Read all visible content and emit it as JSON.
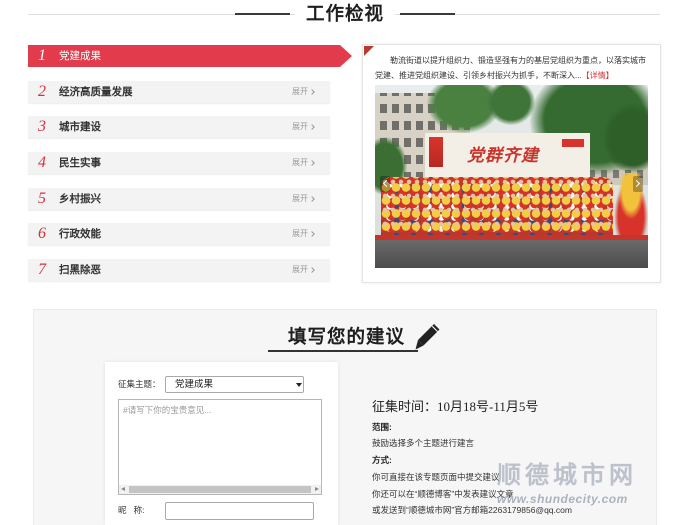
{
  "section_title": "工作检视",
  "topics": [
    {
      "num": "1",
      "label": "党建成果",
      "active": true
    },
    {
      "num": "2",
      "label": "经济高质量发展",
      "expand": "展开"
    },
    {
      "num": "3",
      "label": "城市建设",
      "expand": "展开"
    },
    {
      "num": "4",
      "label": "民生实事",
      "expand": "展开"
    },
    {
      "num": "5",
      "label": "乡村振兴",
      "expand": "展开"
    },
    {
      "num": "6",
      "label": "行政效能",
      "expand": "展开"
    },
    {
      "num": "7",
      "label": "扫黑除恶",
      "expand": "展开"
    }
  ],
  "detail": {
    "summary": "勒流街道以提升组织力、锻造坚强有力的基层党组织为重点，以落实城市党建、推进党组织建设、引领乡村振兴为抓手，不断深入...",
    "more_link": "【详情】",
    "photo_banner": "党群齐建"
  },
  "suggestion": {
    "title": "填写您的建议",
    "topic_label": "征集主题：",
    "topic_selected": "党建成果",
    "textarea_placeholder": "#请写下你的宝贵意见...",
    "nickname_label": "昵   称:",
    "period": "征集时间：10月18号-11月5号",
    "scope_label": "范围:",
    "scope_text": "鼓励选择多个主题进行建言",
    "method_label": "方式:",
    "methods": [
      "你可直接在该专题页面中提交建议",
      "你还可以在“顺德博客”中发表建议文章",
      "或发送到“顺德城市网”官方邮箱2263179856@qq.com"
    ]
  },
  "watermark": {
    "name": "顺德城市网",
    "url": "www.shundecity.com"
  },
  "colors": {
    "accent": "#e23c4c",
    "number": "#d8303b",
    "link": "#d8303b",
    "panel_bg": "#f6f6f6",
    "title_text": "#1e1e1e"
  },
  "icons": {
    "expand": "chevron-right-icon",
    "carousel_prev": "chevron-left-icon",
    "carousel_next": "chevron-right-icon",
    "title_decoration": "pen-icon",
    "select": "caret-down-icon"
  }
}
